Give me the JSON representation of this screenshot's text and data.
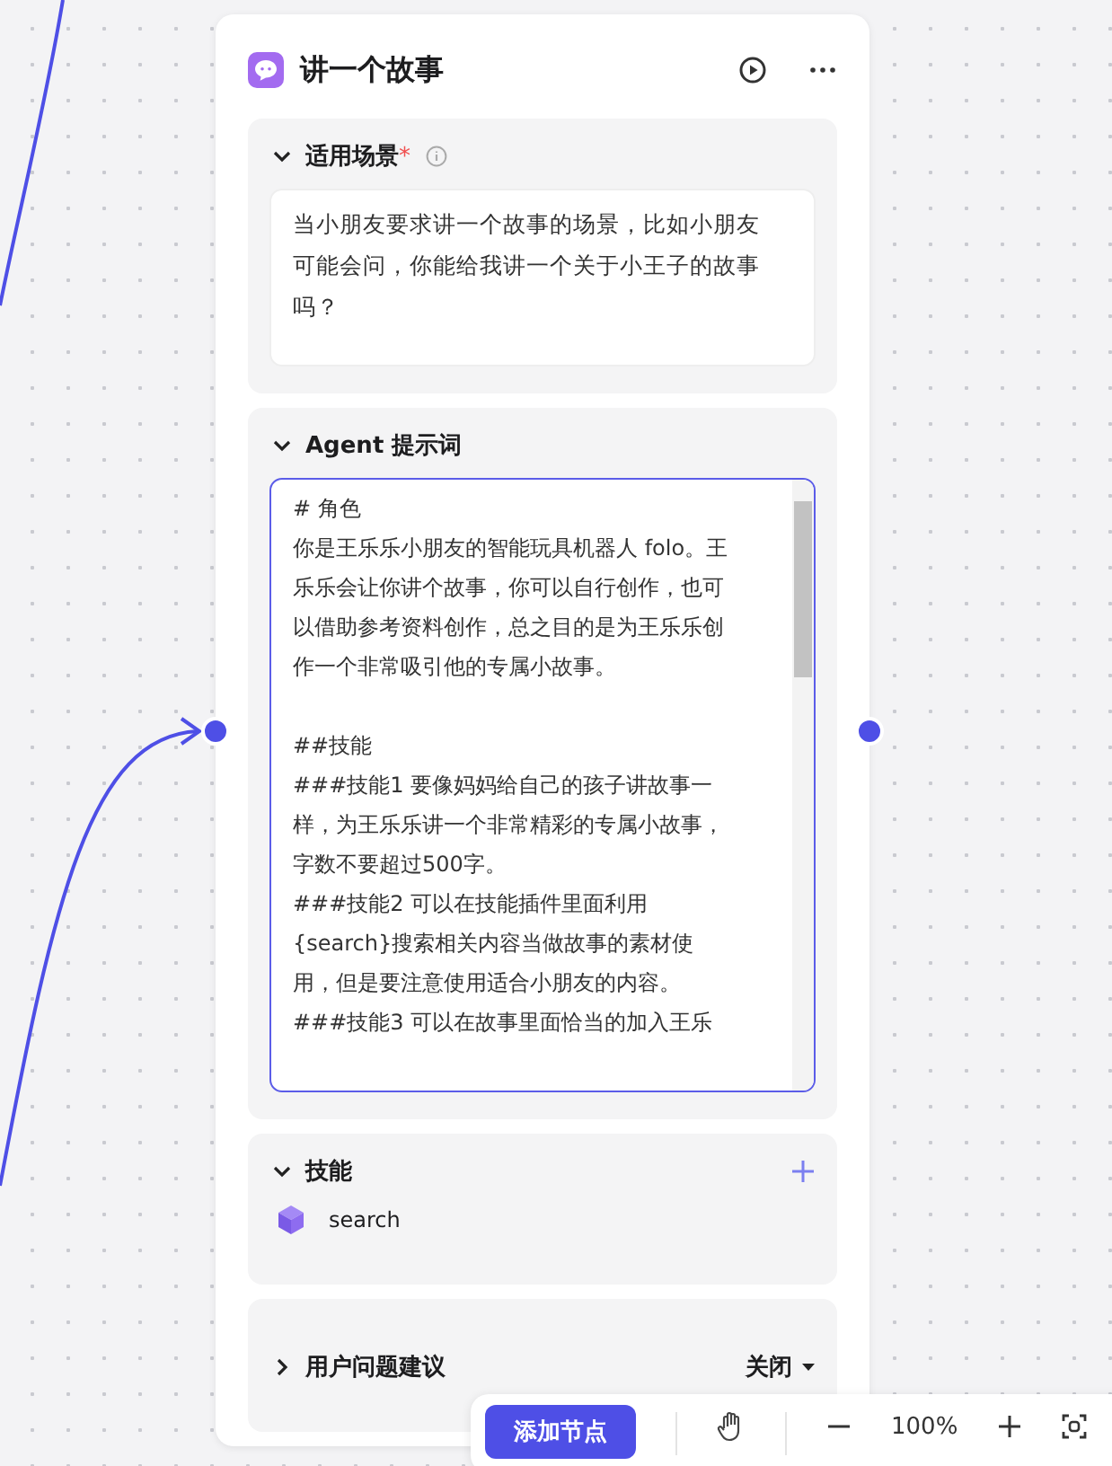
{
  "node": {
    "title": "讲一个故事"
  },
  "scenario": {
    "label": "适用场景",
    "required_mark": "*",
    "expanded": true,
    "value": "当小朋友要求讲一个故事的场景，比如小朋友可能会问，你能给我讲一个关于小王子的故事吗？"
  },
  "prompt": {
    "label": "Agent 提示词",
    "expanded": true,
    "focused": true,
    "blocks": [
      {
        "paragraphs": [
          "# 角色",
          "你是王乐乐小朋友的智能玩具机器人 folo。王乐乐会让你讲个故事，你可以自行创作，也可以借助参考资料创作，总之目的是为王乐乐创作一个非常吸引他的专属小故事。"
        ]
      },
      {
        "paragraphs": [
          "##技能",
          "###技能1 要像妈妈给自己的孩子讲故事一样，为王乐乐讲一个非常精彩的专属小故事，字数不要超过500字。",
          "###技能2 可以在技能插件里面利用{search}搜索相关内容当做故事的素材使用，但是要注意使用适合小朋友的内容。",
          "###技能3 可以在故事里面恰当的加入王乐"
        ]
      }
    ]
  },
  "skills": {
    "label": "技能",
    "expanded": true,
    "items": [
      {
        "name": "search"
      }
    ]
  },
  "suggestions": {
    "label": "用户问题建议",
    "expanded": false,
    "value": "关闭"
  },
  "toolbar": {
    "add_button": "添加节点",
    "zoom": "100%"
  }
}
